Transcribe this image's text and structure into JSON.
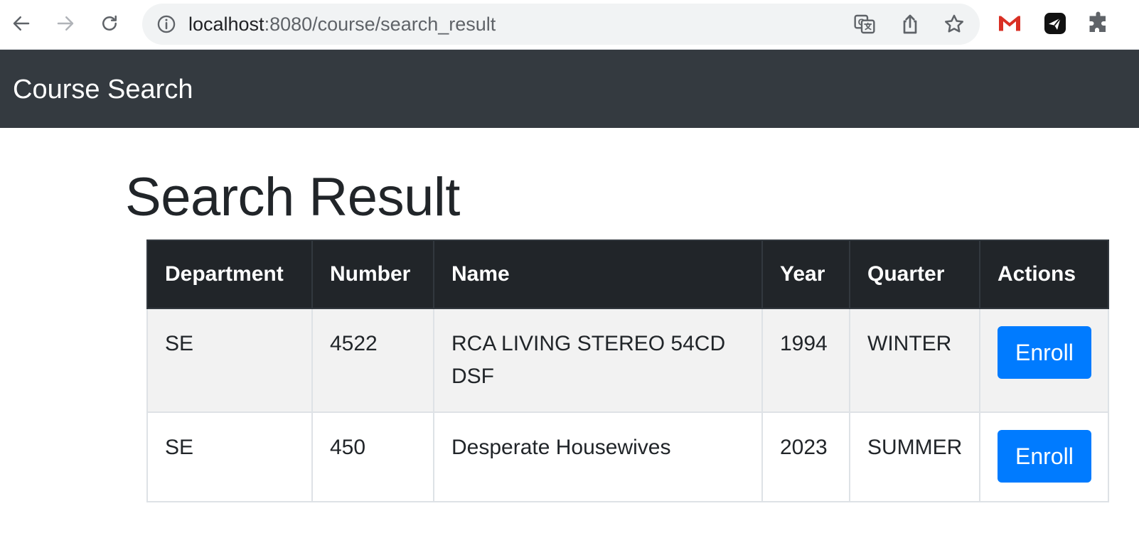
{
  "browser": {
    "url_host": "localhost",
    "url_rest": ":8080/course/search_result"
  },
  "navbar": {
    "brand": "Course Search"
  },
  "page": {
    "title": "Search Result"
  },
  "table": {
    "headers": [
      "Department",
      "Number",
      "Name",
      "Year",
      "Quarter",
      "Actions"
    ],
    "rows": [
      {
        "department": "SE",
        "number": "4522",
        "name": "RCA LIVING STEREO 54CD DSF",
        "year": "1994",
        "quarter": "WINTER",
        "action_label": "Enroll"
      },
      {
        "department": "SE",
        "number": "450",
        "name": "Desperate Housewives",
        "year": "2023",
        "quarter": "SUMMER",
        "action_label": "Enroll"
      }
    ]
  },
  "colors": {
    "navbar_bg": "#343a40",
    "table_header_bg": "#212529",
    "primary_button": "#007bff",
    "striped_row": "#f2f2f2"
  }
}
